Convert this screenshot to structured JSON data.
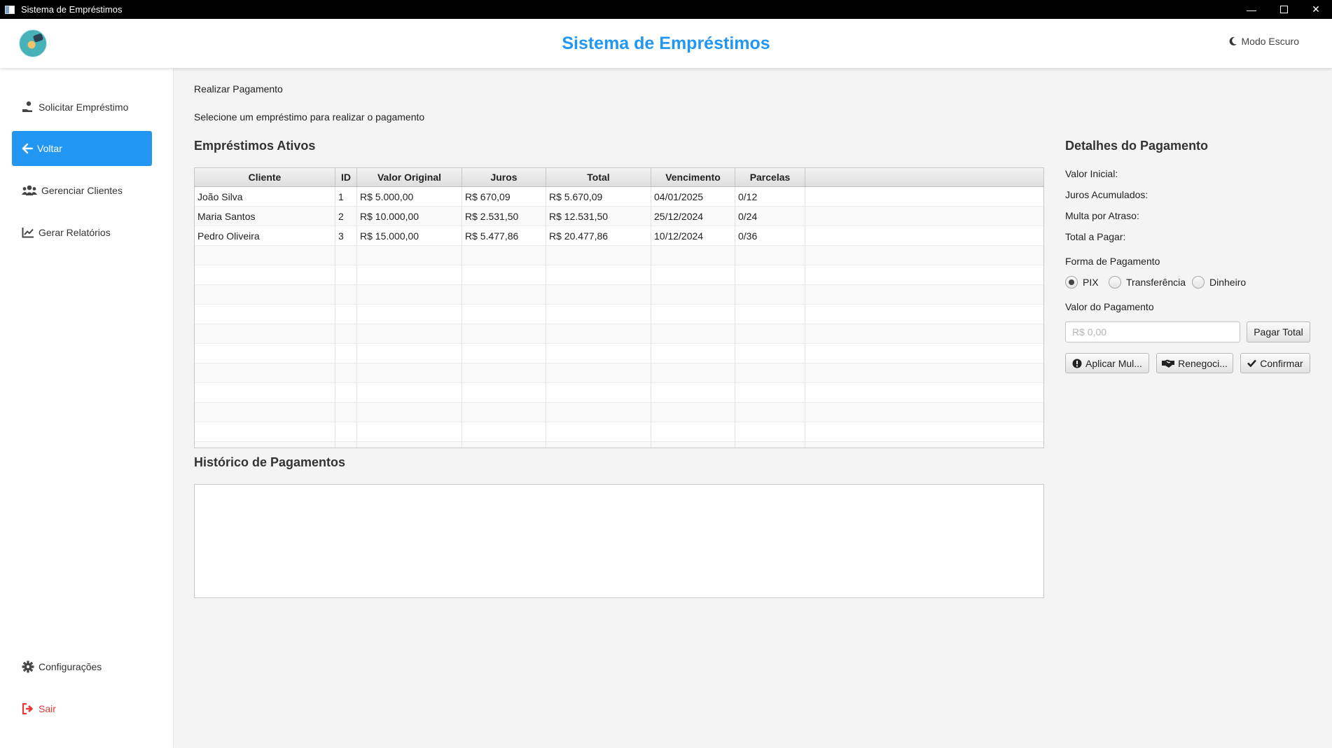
{
  "window": {
    "title": "Sistema de Empréstimos"
  },
  "header": {
    "title": "Sistema de Empréstimos",
    "dark_mode_label": "Modo Escuro"
  },
  "sidebar": {
    "items": [
      {
        "label": "Solicitar Empréstimo",
        "icon": "hand-money-icon"
      },
      {
        "label": "Voltar",
        "icon": "arrow-left-icon"
      },
      {
        "label": "Gerenciar Clientes",
        "icon": "users-icon"
      },
      {
        "label": "Gerar Relatórios",
        "icon": "chart-line-icon"
      },
      {
        "label": "Configurações",
        "icon": "gear-icon"
      },
      {
        "label": "Sair",
        "icon": "sign-out-icon"
      }
    ],
    "active_color": "#2196f3",
    "exit_color": "#e53935"
  },
  "main": {
    "breadcrumb": "Realizar Pagamento",
    "subtitle": "Selecione um empréstimo para realizar o pagamento",
    "loans_title": "Empréstimos Ativos",
    "history_title": "Histórico de Pagamentos"
  },
  "table": {
    "columns": [
      "Cliente",
      "ID",
      "Valor Original",
      "Juros",
      "Total",
      "Vencimento",
      "Parcelas"
    ],
    "rows": [
      [
        "João Silva",
        "1",
        "R$ 5.000,00",
        "R$ 670,09",
        "R$ 5.670,09",
        "04/01/2025",
        "0/12"
      ],
      [
        "Maria Santos",
        "2",
        "R$ 10.000,00",
        "R$ 2.531,50",
        "R$ 12.531,50",
        "25/12/2024",
        "0/24"
      ],
      [
        "Pedro Oliveira",
        "3",
        "R$ 15.000,00",
        "R$ 5.477,86",
        "R$ 20.477,86",
        "10/12/2024",
        "0/36"
      ]
    ]
  },
  "details": {
    "title": "Detalhes do Pagamento",
    "valor_inicial": "Valor Inicial:",
    "juros_acumulados": "Juros Acumulados:",
    "multa_atraso": "Multa por Atraso:",
    "total_pagar": "Total a Pagar:",
    "forma_pagamento": "Forma de Pagamento",
    "payment_methods": [
      "PIX",
      "Transferência",
      "Dinheiro"
    ],
    "selected_method": "PIX",
    "valor_pagamento_label": "Valor do Pagamento",
    "valor_pagamento_placeholder": "R$ 0,00",
    "pagar_total_label": "Pagar Total",
    "aplicar_multa_label": "Aplicar Mul...",
    "renegociar_label": "Renegoci...",
    "confirmar_label": "Confirmar"
  }
}
